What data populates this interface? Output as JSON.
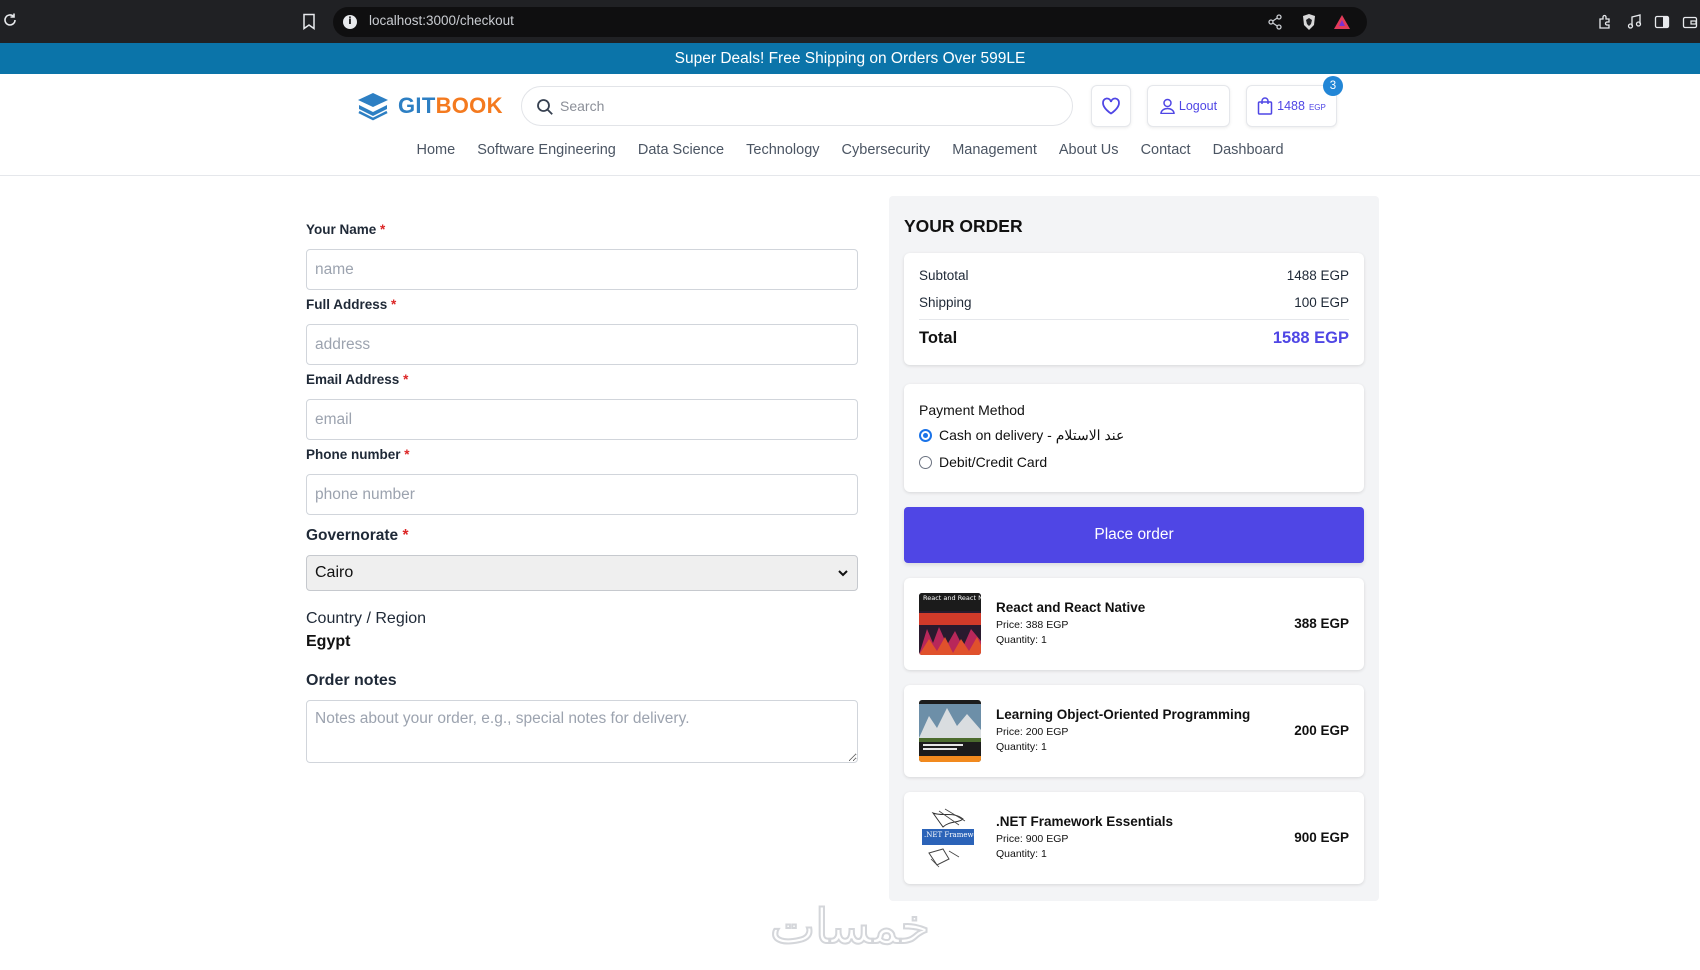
{
  "browser": {
    "url": "localhost:3000/checkout"
  },
  "promo": {
    "text": "Super Deals! Free Shipping on Orders Over 599LE"
  },
  "header": {
    "logo_part1": "GIT",
    "logo_part2": "BOOK",
    "search_placeholder": "Search",
    "logout_label": "Logout",
    "cart_amount": "1488",
    "cart_currency": "EGP",
    "cart_count": "3"
  },
  "nav": [
    "Home",
    "Software Engineering",
    "Data Science",
    "Technology",
    "Cybersecurity",
    "Management",
    "About Us",
    "Contact",
    "Dashboard"
  ],
  "form": {
    "name_label": "Your Name",
    "name_placeholder": "name",
    "address_label": "Full Address",
    "address_placeholder": "address",
    "email_label": "Email Address",
    "email_placeholder": "email",
    "phone_label": "Phone number",
    "phone_placeholder": "phone number",
    "required_mark": "*",
    "governorate_label": "Governorate",
    "governorate_value": "Cairo",
    "country_label": "Country / Region",
    "country_value": "Egypt",
    "notes_label": "Order notes",
    "notes_placeholder": "Notes about your order, e.g., special notes for delivery."
  },
  "order": {
    "title": "YOUR ORDER",
    "subtotal_label": "Subtotal",
    "subtotal_value": "1488 EGP",
    "shipping_label": "Shipping",
    "shipping_value": "100 EGP",
    "total_label": "Total",
    "total_value": "1588 EGP",
    "payment_title": "Payment Method",
    "payment_options": [
      "Cash on delivery - عند الاستلام",
      "Debit/Credit Card"
    ],
    "payment_selected": "Cash on delivery - عند الاستلام",
    "place_order_label": "Place order",
    "items": [
      {
        "title": "React and React Native",
        "price": "Price: 388 EGP",
        "quantity": "Quantity: 1",
        "total": "388 EGP",
        "cover_text": "React and React Native"
      },
      {
        "title": "Learning Object-Oriented Programming",
        "price": "Price: 200 EGP",
        "quantity": "Quantity: 1",
        "total": "200 EGP"
      },
      {
        "title": ".NET Framework Essentials",
        "price": "Price: 900 EGP",
        "quantity": "Quantity: 1",
        "total": "900 EGP",
        "cover_text": ".NET Framework"
      }
    ]
  },
  "watermark": "خمسات",
  "colors": {
    "promo_bg": "#0b74a9",
    "accent": "#4f46e5",
    "logo_blue": "#2d7fc3",
    "logo_orange": "#f47a1f",
    "required": "#dc2626"
  }
}
